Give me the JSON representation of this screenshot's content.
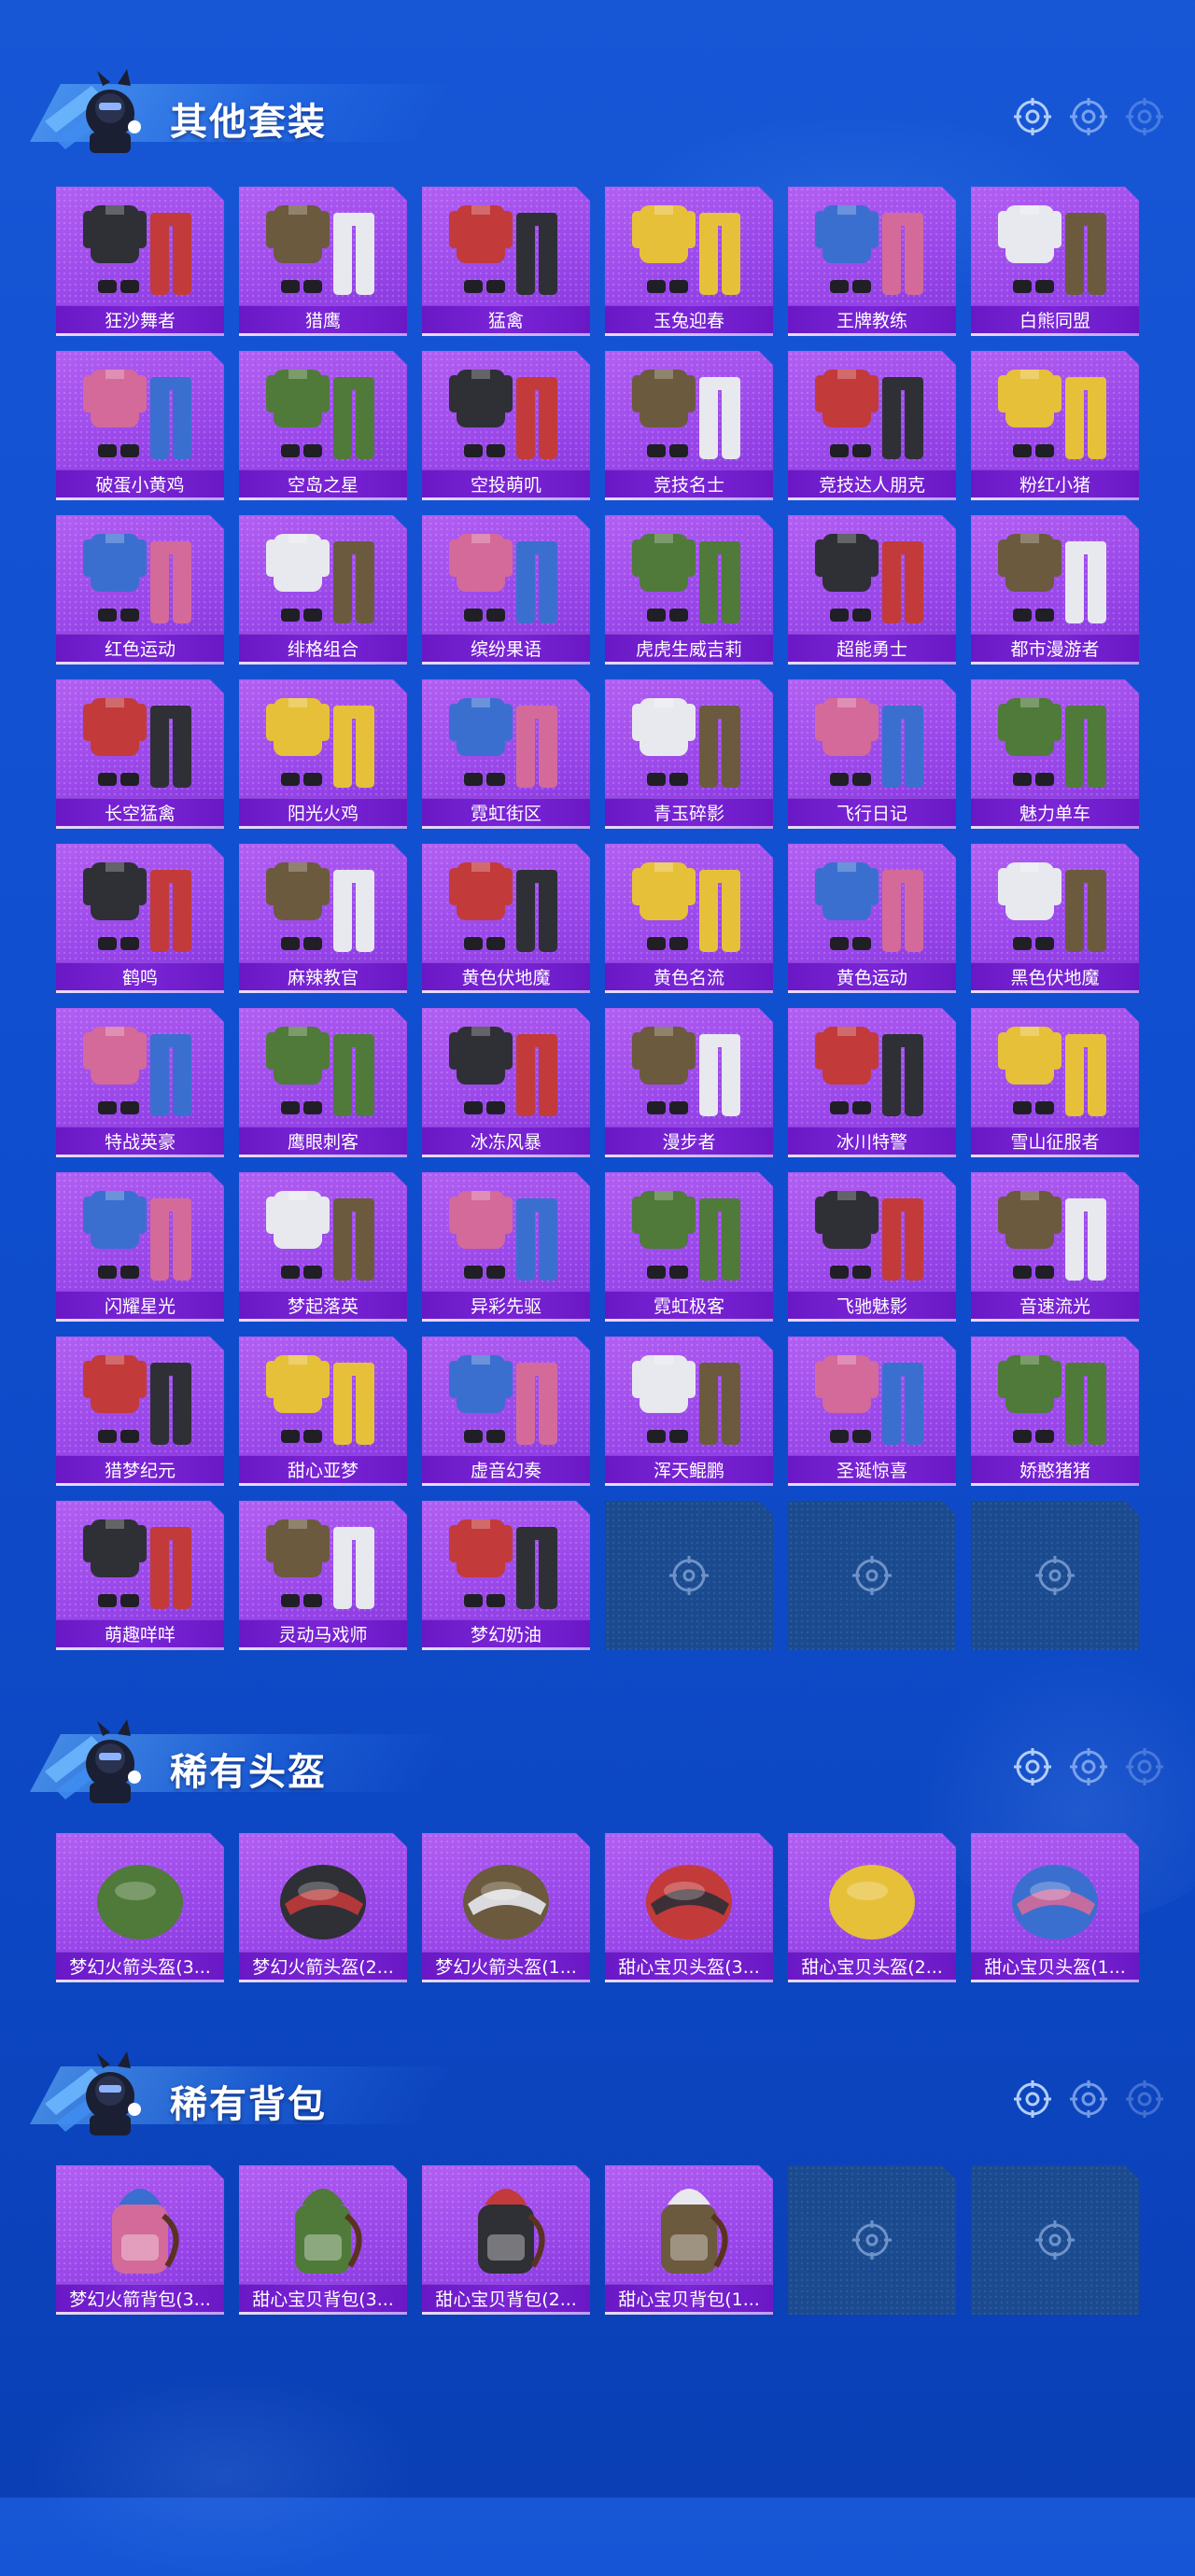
{
  "colors": {
    "background": "#1757d6",
    "item_bg": "#9a47ea",
    "label_bg": "#6a18c6",
    "empty_bg": "#1b4a8f",
    "title_text": "#ffffff"
  },
  "sections": [
    {
      "title": "其他套装",
      "badge_icon": "player-badge-icon",
      "items": [
        {
          "label": "狂沙舞者",
          "icon": "outfit-icon"
        },
        {
          "label": "猎鹰",
          "icon": "outfit-icon"
        },
        {
          "label": "猛禽",
          "icon": "outfit-icon"
        },
        {
          "label": "玉兔迎春",
          "icon": "outfit-icon"
        },
        {
          "label": "王牌教练",
          "icon": "outfit-icon"
        },
        {
          "label": "白熊同盟",
          "icon": "outfit-icon"
        },
        {
          "label": "破蛋小黄鸡",
          "icon": "outfit-icon"
        },
        {
          "label": "空岛之星",
          "icon": "outfit-icon"
        },
        {
          "label": "空投萌叽",
          "icon": "outfit-icon"
        },
        {
          "label": "竞技名士",
          "icon": "outfit-icon"
        },
        {
          "label": "竞技达人朋克",
          "icon": "outfit-icon"
        },
        {
          "label": "粉红小猪",
          "icon": "outfit-icon"
        },
        {
          "label": "红色运动",
          "icon": "outfit-icon"
        },
        {
          "label": "绯格组合",
          "icon": "outfit-icon"
        },
        {
          "label": "缤纷果语",
          "icon": "outfit-icon"
        },
        {
          "label": "虎虎生威吉莉",
          "icon": "outfit-icon"
        },
        {
          "label": "超能勇士",
          "icon": "outfit-icon"
        },
        {
          "label": "都市漫游者",
          "icon": "outfit-icon"
        },
        {
          "label": "长空猛禽",
          "icon": "outfit-icon"
        },
        {
          "label": "阳光火鸡",
          "icon": "outfit-icon"
        },
        {
          "label": "霓虹街区",
          "icon": "outfit-icon"
        },
        {
          "label": "青玉碎影",
          "icon": "outfit-icon"
        },
        {
          "label": "飞行日记",
          "icon": "outfit-icon"
        },
        {
          "label": "魅力单车",
          "icon": "outfit-icon"
        },
        {
          "label": "鹤鸣",
          "icon": "outfit-icon"
        },
        {
          "label": "麻辣教官",
          "icon": "outfit-icon"
        },
        {
          "label": "黄色伏地魔",
          "icon": "outfit-icon"
        },
        {
          "label": "黄色名流",
          "icon": "outfit-icon"
        },
        {
          "label": "黄色运动",
          "icon": "outfit-icon"
        },
        {
          "label": "黑色伏地魔",
          "icon": "outfit-icon"
        },
        {
          "label": "特战英豪",
          "icon": "outfit-icon"
        },
        {
          "label": "鹰眼刺客",
          "icon": "outfit-icon"
        },
        {
          "label": "冰冻风暴",
          "icon": "outfit-icon"
        },
        {
          "label": "漫步者",
          "icon": "outfit-icon"
        },
        {
          "label": "冰川特警",
          "icon": "outfit-icon"
        },
        {
          "label": "雪山征服者",
          "icon": "outfit-icon"
        },
        {
          "label": "闪耀星光",
          "icon": "outfit-icon"
        },
        {
          "label": "梦起落英",
          "icon": "outfit-icon"
        },
        {
          "label": "异彩先驱",
          "icon": "outfit-icon"
        },
        {
          "label": "霓虹极客",
          "icon": "outfit-icon"
        },
        {
          "label": "飞驰魅影",
          "icon": "outfit-icon"
        },
        {
          "label": "音速流光",
          "icon": "outfit-icon"
        },
        {
          "label": "猎梦纪元",
          "icon": "outfit-icon"
        },
        {
          "label": "甜心亚梦",
          "icon": "outfit-icon"
        },
        {
          "label": "虚音幻奏",
          "icon": "outfit-icon"
        },
        {
          "label": "浑天鲲鹏",
          "icon": "outfit-icon"
        },
        {
          "label": "圣诞惊喜",
          "icon": "outfit-icon"
        },
        {
          "label": "娇憨猪猪",
          "icon": "outfit-icon"
        },
        {
          "label": "萌趣咩咩",
          "icon": "outfit-icon"
        },
        {
          "label": "灵动马戏师",
          "icon": "outfit-icon"
        },
        {
          "label": "梦幻奶油",
          "icon": "outfit-icon"
        }
      ],
      "empty_slots": 3
    },
    {
      "title": "稀有头盔",
      "badge_icon": "player-badge-icon",
      "items": [
        {
          "label": "梦幻火箭头盔(3...",
          "icon": "helmet-icon"
        },
        {
          "label": "梦幻火箭头盔(2...",
          "icon": "helmet-icon"
        },
        {
          "label": "梦幻火箭头盔(1...",
          "icon": "helmet-icon"
        },
        {
          "label": "甜心宝贝头盔(3...",
          "icon": "helmet-icon"
        },
        {
          "label": "甜心宝贝头盔(2...",
          "icon": "helmet-icon"
        },
        {
          "label": "甜心宝贝头盔(1...",
          "icon": "helmet-icon"
        }
      ],
      "empty_slots": 0
    },
    {
      "title": "稀有背包",
      "badge_icon": "player-badge-icon",
      "items": [
        {
          "label": "梦幻火箭背包(3...",
          "icon": "backpack-icon"
        },
        {
          "label": "甜心宝贝背包(3...",
          "icon": "backpack-icon"
        },
        {
          "label": "甜心宝贝背包(2...",
          "icon": "backpack-icon"
        },
        {
          "label": "甜心宝贝背包(1...",
          "icon": "backpack-icon"
        }
      ],
      "empty_slots": 2
    }
  ]
}
